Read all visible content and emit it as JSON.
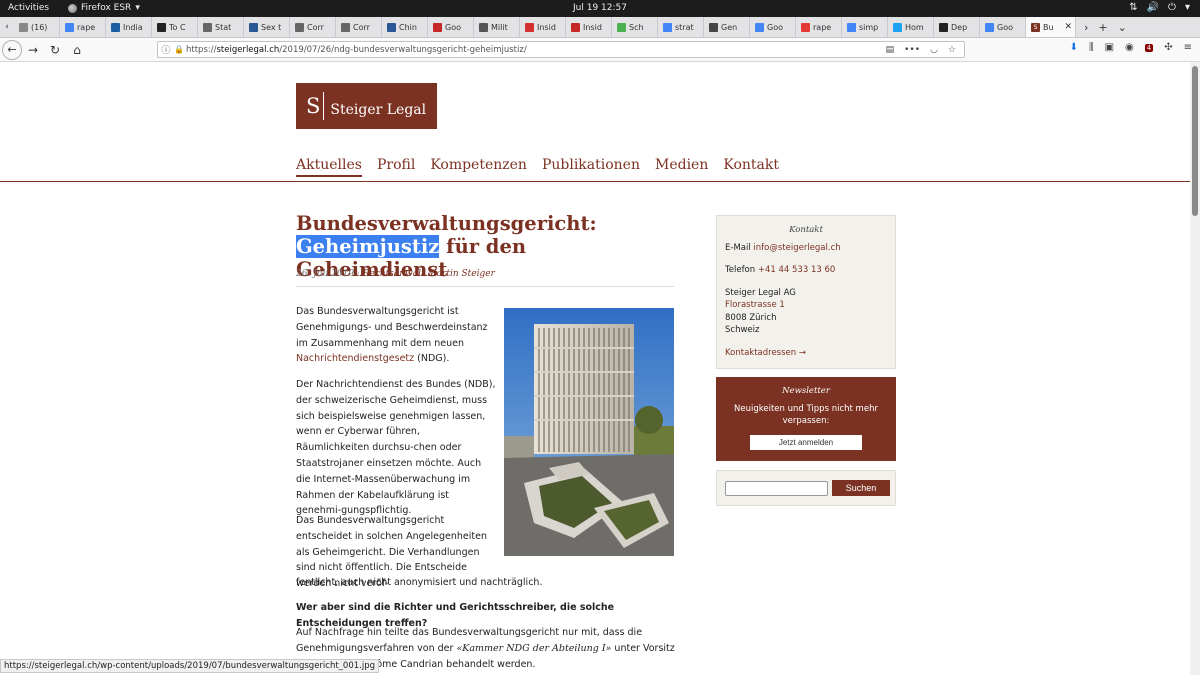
{
  "system_bar": {
    "activities": "Activities",
    "app_name": "Firefox ESR",
    "clock": "Jul 19  12:57"
  },
  "tabs": [
    {
      "label": "(16)",
      "fav": "#888"
    },
    {
      "label": "rape",
      "fav": "#4285f4"
    },
    {
      "label": "India",
      "fav": "#1a5fa3"
    },
    {
      "label": "To C",
      "fav": "#222"
    },
    {
      "label": "Stat",
      "fav": "#666"
    },
    {
      "label": "Sex t",
      "fav": "#2b5797"
    },
    {
      "label": "Corr",
      "fav": "#666"
    },
    {
      "label": "Corr",
      "fav": "#666"
    },
    {
      "label": "Chin",
      "fav": "#2b5797"
    },
    {
      "label": "Goo",
      "fav": "#c62828"
    },
    {
      "label": "Milit",
      "fav": "#555"
    },
    {
      "label": "Insid",
      "fav": "#d32f2f"
    },
    {
      "label": "Insid",
      "fav": "#c62828"
    },
    {
      "label": "Sch",
      "fav": "#4caf50"
    },
    {
      "label": "strat",
      "fav": "#4285f4"
    },
    {
      "label": "Gen",
      "fav": "#444"
    },
    {
      "label": "Goo",
      "fav": "#4285f4"
    },
    {
      "label": "rape",
      "fav": "#e53935"
    },
    {
      "label": "simp",
      "fav": "#4285f4"
    },
    {
      "label": "Hom",
      "fav": "#1da1f2"
    },
    {
      "label": "Dep",
      "fav": "#222"
    },
    {
      "label": "Goo",
      "fav": "#4285f4"
    }
  ],
  "active_tab": {
    "label": "Bu",
    "fav": "#7b3222"
  },
  "navbar": {
    "url_prefix": "https://",
    "url_domain": "steigerlegal.ch",
    "url_path": "/2019/07/26/ndg-bundesverwaltungsgericht-geheimjustiz/",
    "ublock_count": "4"
  },
  "site": {
    "logo_letter": "S",
    "logo_name": "Steiger Legal",
    "nav": [
      "Aktuelles",
      "Profil",
      "Kompetenzen",
      "Publikationen",
      "Medien",
      "Kontakt"
    ]
  },
  "article": {
    "title_line1": "Bundesverwaltungsgericht:",
    "title_highlight": "Geheimjustiz",
    "title_rest": " für den Geheimdienst",
    "date": "26. Juli 2019",
    "sep": " · ",
    "author": "Rechtsanwalt Martin Steiger",
    "p1_a": "Das Bundesverwaltungsgericht ist Genehmigungs- und Beschwerdeinstanz im Zusammenhang mit dem neuen ",
    "p1_link": "Nachrichtendienstgesetz",
    "p1_b": " (NDG).",
    "p2": "Der Nachrichtendienst des Bundes (NDB), der schweizerische Geheimdienst, muss sich beispielsweise genehmigen lassen, wenn er Cyberwar führen, Räumlichkeiten durchsu-chen oder Staatstrojaner einsetzen möchte. Auch die Internet-Massenüberwachung im Rahmen der Kabelaufklärung ist genehmi-gungspflichtig.",
    "p3a": "Das Bundesverwaltungsgericht entscheidet in solchen Angelegenheiten als Geheimgericht. Die Verhandlungen sind nicht öffentlich. Die Entscheide werden nicht veröf-",
    "p3b": "fentlicht, auch nicht anonymisiert und nachträglich.",
    "question": "Wer aber sind die Richter und Gerichtsschreiber, die solche Entscheidungen treffen?",
    "p4_a": "Auf Nachfrage hin teilte das Bundesverwaltungsgericht nur mit, dass die Genehmigungsverfahren von der ",
    "p4_q": "«Kammer NDG der Abteilung I»",
    "p4_b": " unter Vorsitz von Präsident Jérôme Candrian behandelt werden."
  },
  "sidebar": {
    "contact_heading": "Kontakt",
    "email_label": "E-Mail ",
    "email": "info@steigerlegal.ch",
    "phone_label": "Telefon ",
    "phone": "+41 44 533 13 60",
    "company": "Steiger Legal AG",
    "street": "Florastrasse 1",
    "city": "8008 Zürich",
    "country": "Schweiz",
    "addresses_link": "Kontaktadressen →",
    "newsletter_heading": "Newsletter",
    "newsletter_text": "Neuigkeiten und Tipps nicht mehr verpassen:",
    "newsletter_button": "Jetzt anmelden",
    "search_button": "Suchen",
    "search_value": ""
  },
  "statusbar": {
    "link": "https://steigerlegal.ch/wp-content/uploads/2019/07/bundesverwaltungsgericht_001.jpg"
  },
  "colors": {
    "brand": "#7b3222",
    "selection": "#3c7ff0"
  }
}
